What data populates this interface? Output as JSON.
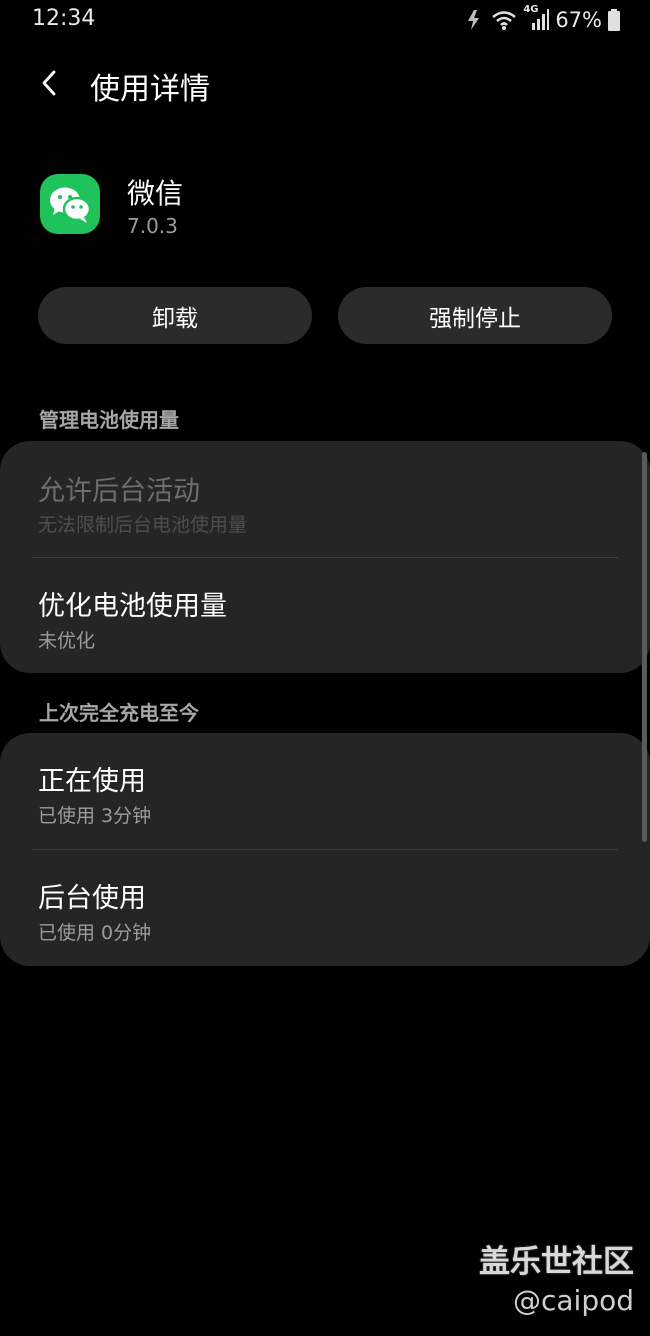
{
  "status_bar": {
    "time": "12:34",
    "battery_percent": "67%",
    "network_label": "4G",
    "icons": [
      "charging-icon",
      "wifi-icon",
      "signal-icon",
      "battery-icon"
    ]
  },
  "header": {
    "title": "使用详情"
  },
  "app": {
    "name": "微信",
    "version": "7.0.3",
    "icon": "wechat-icon",
    "icon_color": "#1fc25b"
  },
  "actions": {
    "uninstall": "卸载",
    "force_stop": "强制停止"
  },
  "battery_section": {
    "heading": "管理电池使用量",
    "items": [
      {
        "title": "允许后台活动",
        "subtitle": "无法限制后台电池使用量",
        "disabled": true
      },
      {
        "title": "优化电池使用量",
        "subtitle": "未优化"
      }
    ]
  },
  "usage_section": {
    "heading": "上次完全充电至今",
    "items": [
      {
        "title": "正在使用",
        "subtitle": "已使用 3分钟"
      },
      {
        "title": "后台使用",
        "subtitle": "已使用 0分钟"
      }
    ]
  },
  "watermark": {
    "title": "盖乐世社区",
    "handle": "@caipod"
  }
}
